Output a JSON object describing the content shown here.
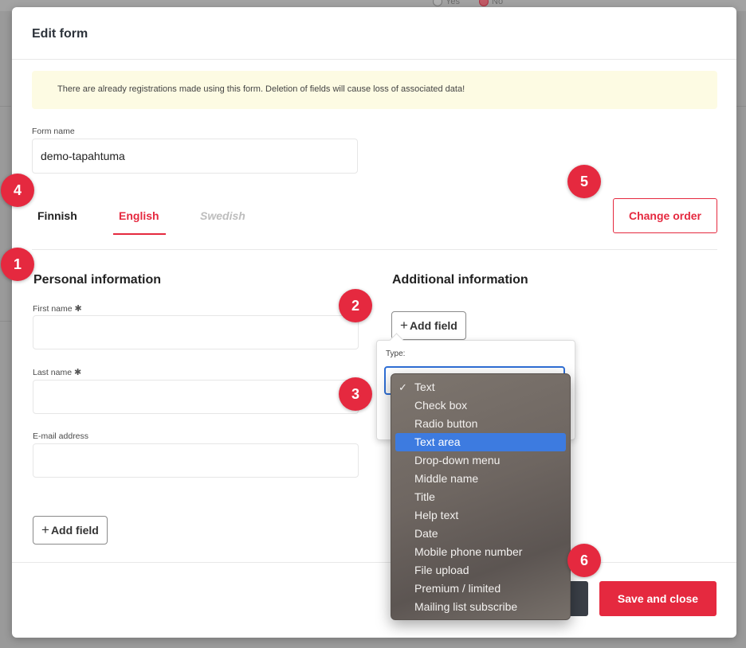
{
  "background": {
    "radio_yes": "Yes",
    "radio_no": "No"
  },
  "modal": {
    "title": "Edit form",
    "warning": "There are already registrations made using this form. Deletion of fields will cause loss of associated data!",
    "form_name_label": "Form name",
    "form_name_value": "demo-tapahtuma"
  },
  "tabs": [
    {
      "label": "Finnish",
      "state": "normal"
    },
    {
      "label": "English",
      "state": "active"
    },
    {
      "label": "Swedish",
      "state": "disabled"
    }
  ],
  "change_order_label": "Change order",
  "personal": {
    "title": "Personal information",
    "fields": [
      {
        "label": "First name",
        "required": true,
        "required_mark": "✱"
      },
      {
        "label": "Last name",
        "required": true,
        "required_mark": "✱"
      },
      {
        "label": "E-mail address",
        "required": false
      }
    ],
    "add_field_label": "Add field",
    "plus": "+"
  },
  "additional": {
    "title": "Additional information",
    "add_field_label": "Add field",
    "plus": "+",
    "popover_type_label": "Type:"
  },
  "dropdown": {
    "selected": "Text",
    "highlighted": "Text area",
    "check_mark": "✓",
    "options": [
      "Text",
      "Check box",
      "Radio button",
      "Text area",
      "Drop-down menu",
      "Middle name",
      "Title",
      "Help text",
      "Date",
      "Mobile phone number",
      "File upload",
      "Premium / limited",
      "Mailing list subscribe"
    ]
  },
  "footer": {
    "save_and_close_label": "Save and close"
  },
  "badges": [
    "1",
    "2",
    "3",
    "4",
    "5",
    "6"
  ],
  "colors": {
    "accent": "#e5293f",
    "highlight": "#3d7be0",
    "warning_bg": "#fdfbe3"
  }
}
